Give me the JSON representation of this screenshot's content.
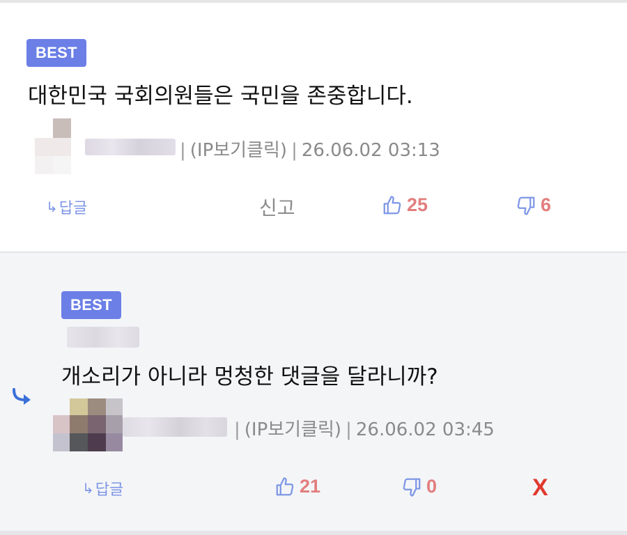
{
  "comments": [
    {
      "badge": "BEST",
      "text": "대한민국 국회의원들은 국민을 존중합니다.",
      "ip_label": "(IP보기클릭)",
      "timestamp": "26.06.02 03:13",
      "reply_label": "답글",
      "report_label": "신고",
      "likes": "25",
      "dislikes": "6",
      "colors": {
        "like": "#e27e7e",
        "icon": "#7d96e6"
      }
    },
    {
      "badge": "BEST",
      "text": "개소리가 아니라 멍청한 댓글을 달라니까?",
      "ip_label": "(IP보기클릭)",
      "timestamp": "26.06.02 03:45",
      "reply_label": "답글",
      "likes": "21",
      "dislikes": "0",
      "delete_label": "X",
      "is_reply": true
    }
  ],
  "colors": {
    "badge": "#6b7fe6",
    "reply_bg": "#f4f5f7",
    "delete": "#e03a2f"
  }
}
